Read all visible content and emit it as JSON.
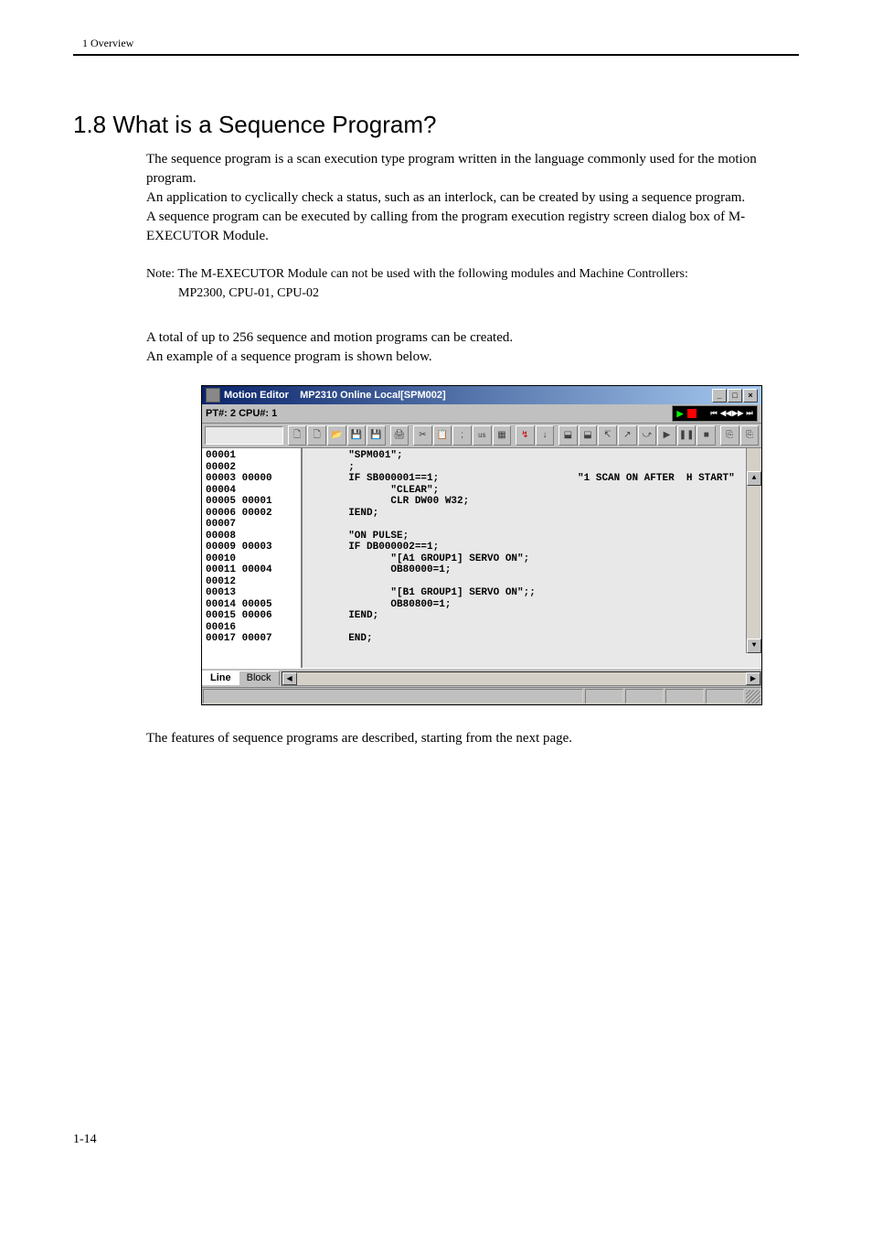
{
  "header": {
    "chapter": "1  Overview"
  },
  "section": {
    "heading": "1.8  What is a Sequence Program?"
  },
  "paragraphs": {
    "p1": "The sequence program is a scan execution type program written in the language commonly used for the motion program.",
    "p2": "An application to cyclically check a status, such as an interlock, can be created by using a sequence program.",
    "p3": "A sequence program can be executed by calling from the program execution registry screen dialog box of M-EXECUTOR Module.",
    "note_label": "Note:",
    "note_body": "The M-EXECUTOR Module can not be used with the following modules and Machine Controllers:",
    "note_body2": "MP2300, CPU-01, CPU-02",
    "p4": "A total of up to 256 sequence and motion programs can be created.",
    "p5": "An example of a sequence program is shown below.",
    "p6": "The features of sequence programs are described, starting from the next page."
  },
  "window": {
    "title_app": "Motion Editor",
    "title_doc": "MP2310   Online  Local[SPM002]",
    "subtitle": "PT#: 2 CPU#: 1",
    "tabs": {
      "line": "Line",
      "block": "Block"
    }
  },
  "gutter_lines": "00001\n00002\n00003 00000\n00004\n00005 00001\n00006 00002\n00007\n00008\n00009 00003\n00010\n00011 00004\n00012\n00013\n00014 00005\n00015 00006\n00016\n00017 00007",
  "code_lines": "       \"SPM001\";\n       ;\n       IF SB000001==1;                       \"1 SCAN ON AFTER  H START\"\n              \"CLEAR\";\n              CLR DW00 W32;\n       IEND;\n\n       \"ON PULSE;\n       IF DB000002==1;\n              \"[A1 GROUP1] SERVO ON\";\n              OB80000=1;\n\n              \"[B1 GROUP1] SERVO ON\";;\n              OB80800=1;\n       IEND;\n\n       END;",
  "page_number": "1-14"
}
